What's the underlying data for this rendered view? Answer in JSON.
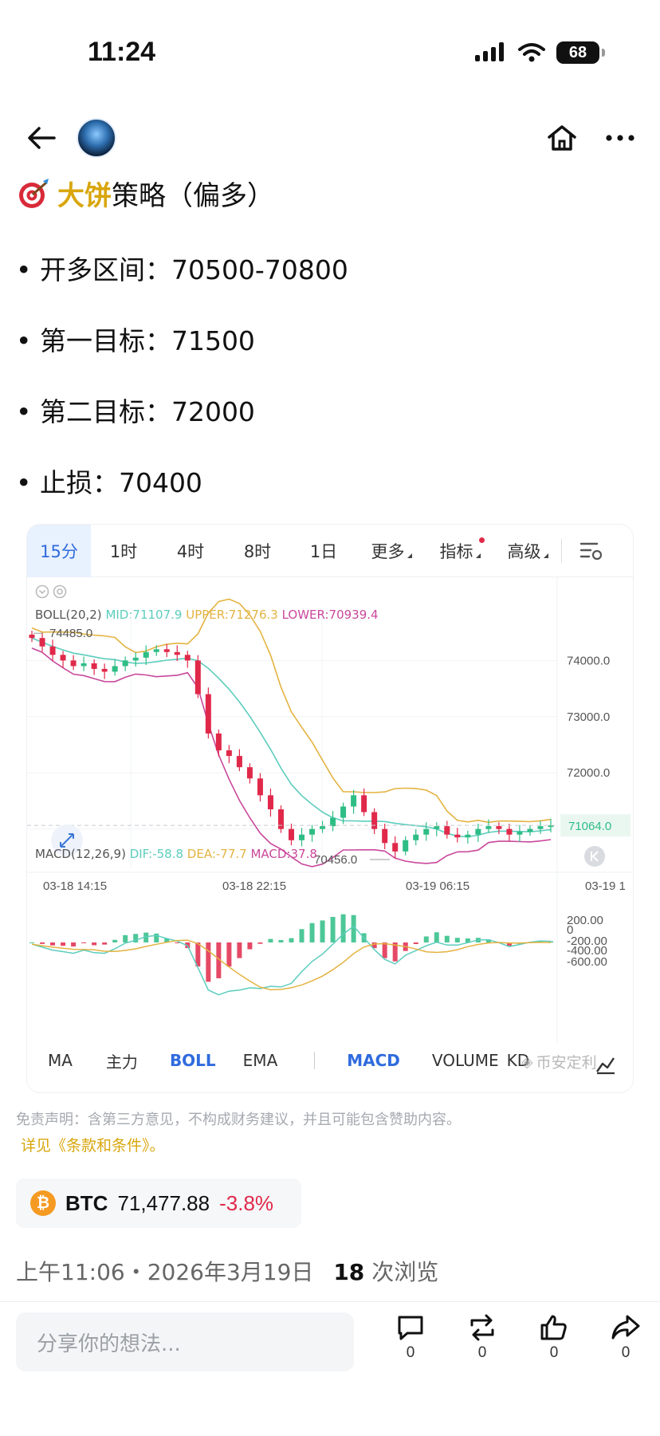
{
  "status_bar": {
    "time": "11:24",
    "battery": "68"
  },
  "post": {
    "title_prefix": "大饼",
    "title_suffix": "策略（偏多）",
    "bullets": [
      "• 开多区间：70500-70800",
      "• 第一目标：71500",
      "• 第二目标：72000",
      "• 止损：70400"
    ]
  },
  "chart": {
    "tabs": [
      "15分",
      "1时",
      "4时",
      "8时",
      "1日",
      "更多",
      "指标",
      "高级"
    ],
    "boll_legend": {
      "name": "BOLL(20,2)",
      "mid": "MID:71107.9",
      "upper": "UPPER:71276.3",
      "lower": "LOWER:70939.4"
    },
    "macd_legend": {
      "name": "MACD(12,26,9)",
      "dif": "DIF:-58.8",
      "dea": "DEA:-77.7",
      "macd": "MACD:37.8"
    },
    "high_label": "74485.0",
    "low_label": "70456.0",
    "price_tag": "71064.0",
    "price_axis": [
      "74000.0",
      "73000.0",
      "72000.0"
    ],
    "time_axis": [
      "03-18 14:15",
      "03-18 22:15",
      "03-19 06:15",
      "03-19 1"
    ],
    "macd_axis": [
      "200.00",
      "0",
      "-200.00",
      "-400.00",
      "-600.00"
    ],
    "indicator_tabs": [
      "MA",
      "主力",
      "BOLL",
      "EMA",
      "MACD",
      "VOLUME",
      "KD"
    ],
    "watermark": "币安定利",
    "colors": {
      "up": "#2ebd85",
      "down": "#e0294a",
      "mid": "#5ccdbd",
      "upper": "#e3b341",
      "lower": "#c9489b",
      "active": "#2f6bde"
    }
  },
  "chart_data": {
    "type": "candlestick",
    "symbol": "BTC",
    "interval": "15分",
    "x_labels": [
      "03-18 14:15",
      "03-18 22:15",
      "03-19 06:15"
    ],
    "ylim": [
      70300,
      74800
    ],
    "close_approx": [
      74400,
      74250,
      74100,
      74000,
      73900,
      73950,
      73850,
      73800,
      73900,
      74000,
      74050,
      74150,
      74200,
      74150,
      74100,
      74000,
      73400,
      72700,
      72400,
      72300,
      72100,
      71900,
      71600,
      71350,
      71000,
      70800,
      70900,
      71000,
      71050,
      71200,
      71400,
      71600,
      71300,
      71000,
      70750,
      70600,
      70800,
      70900,
      71000,
      71050,
      70900,
      70850,
      70900,
      71000,
      71050,
      71000,
      70900,
      70950,
      71000,
      71050,
      71064
    ],
    "boll": {
      "mid": 71107.9,
      "upper": 71276.3,
      "lower": 70939.4
    },
    "macd": {
      "dif": -58.8,
      "dea": -77.7,
      "macd": 37.8
    },
    "high": 74485.0,
    "low": 70456.0,
    "last": 71064.0
  },
  "disclaimer": "免责声明：含第三方意见，不构成财务建议，并且可能包含赞助内容。",
  "terms_link": "详见《条款和条件》。",
  "ticker": {
    "symbol": "BTC",
    "price": "71,477.88",
    "change": "-3.8%"
  },
  "meta": {
    "time": "上午11:06・2026年3月19日",
    "views_count": "18",
    "views_label": "次浏览"
  },
  "comment_placeholder": "分享你的想法...",
  "actions": [
    {
      "name": "comment",
      "count": "0"
    },
    {
      "name": "repost",
      "count": "0"
    },
    {
      "name": "like",
      "count": "0"
    },
    {
      "name": "share",
      "count": "0"
    }
  ]
}
